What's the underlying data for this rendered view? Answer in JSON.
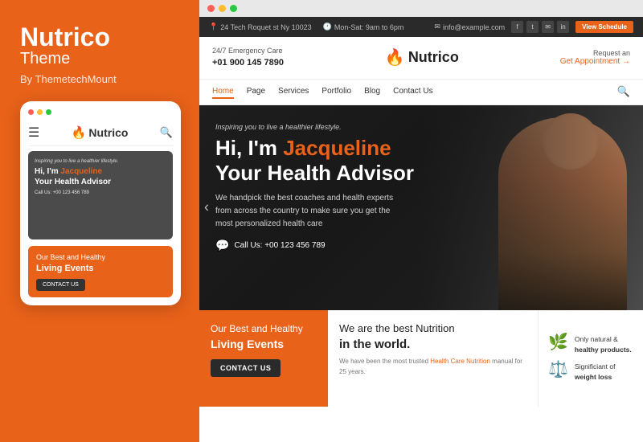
{
  "brand": {
    "name": "Nutrico",
    "sub": "Theme",
    "by": "By ThemetechMount"
  },
  "desktop": {
    "topbar": {
      "address": "24 Tech Roquet st Ny 10023",
      "hours": "Mon-Sat: 9am to 6pm",
      "email": "info@example.com",
      "view_schedule": "View Schedule"
    },
    "header": {
      "emergency_label": "24/7 Emergency Care",
      "phone": "+01 900 145 7890",
      "logo_name": "Nutrico",
      "request_label": "Request an",
      "appointment_label": "Get Appointment →"
    },
    "nav": {
      "links": [
        "Home",
        "Page",
        "Services",
        "Portfolio",
        "Blog",
        "Contact Us"
      ]
    },
    "hero": {
      "inspiring": "Inspiring you to live a healthier lifestyle.",
      "title_line1": "Hi, I'm ",
      "title_orange": "Jacqueline",
      "title_line2": "Your Health Advisor",
      "subtitle": "We handpick the best coaches and health experts from across the country to make sure you get the most personalized health care",
      "call_label": "Call Us: +00 123 456 789"
    },
    "bottom": {
      "events_title": "Our Best and Healthy",
      "events_bold": "Living Events",
      "contact_btn": "CONTACT US",
      "nutrition_title": "We are the best Nutrition",
      "nutrition_bold": "in the world.",
      "nutrition_desc": "We have been the most trusted Health Care Nutrition manual for 25 years.",
      "feature1_text": "Only natural &",
      "feature1_bold": "healthy products.",
      "feature2_text": "Significiant of",
      "feature2_bold": "weight loss"
    }
  },
  "mobile": {
    "logo": "Nutrico",
    "inspiring": "Inspiring you to live a healthier lifestyle.",
    "hi_line": "Hi, I'm",
    "orange_name": "Jacqueline",
    "subtitle": "Your Health Advisor",
    "call_us": "Call Us: +00 123 456 789",
    "events_title": "Our Best and Healthy",
    "events_bold": "Living Events",
    "contact_btn": "CONTACT US"
  },
  "dots": {
    "red": "#ff5f57",
    "yellow": "#febc2e",
    "green": "#28c840"
  }
}
